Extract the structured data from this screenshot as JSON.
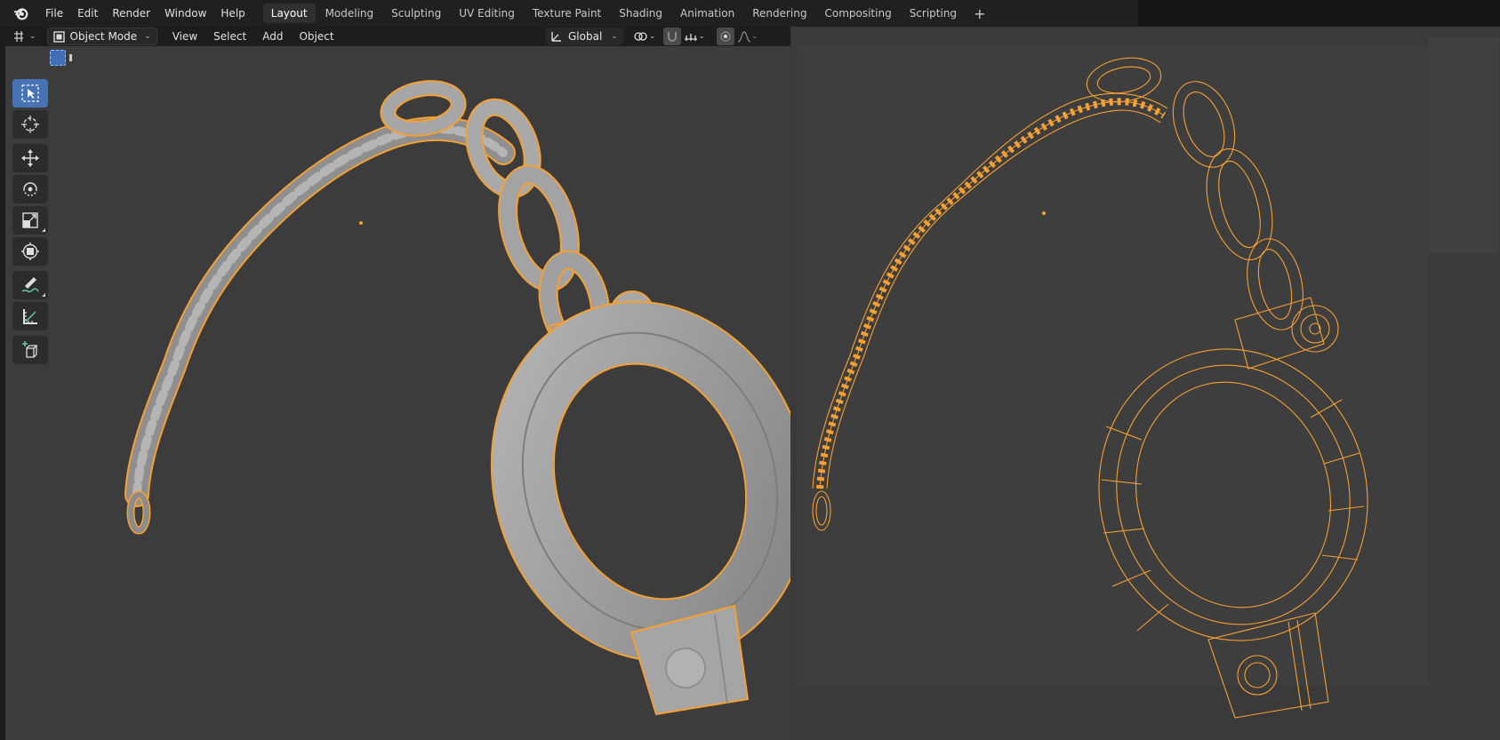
{
  "menu": {
    "items": [
      "File",
      "Edit",
      "Render",
      "Window",
      "Help"
    ]
  },
  "workspaces": {
    "tabs": [
      "Layout",
      "Modeling",
      "Sculpting",
      "UV Editing",
      "Texture Paint",
      "Shading",
      "Animation",
      "Rendering",
      "Compositing",
      "Scripting"
    ],
    "active": "Layout",
    "add_label": "+"
  },
  "viewport_header": {
    "mode": "Object Mode",
    "menus": [
      "View",
      "Select",
      "Add",
      "Object"
    ],
    "orientation": "Global"
  },
  "toolbar": {
    "tools": [
      "select-box",
      "cursor",
      "move",
      "rotate",
      "scale",
      "transform",
      "annotate",
      "measure",
      "add-cube"
    ],
    "active_tool": "select-box"
  },
  "colors": {
    "selection_outline": "#f5a033",
    "active_tool": "#4772b3",
    "viewport_bg": "#3c3c3c",
    "solid_mesh": "#9a9a9a"
  },
  "views": {
    "left": "solid-shaded",
    "right": "wireframe"
  }
}
